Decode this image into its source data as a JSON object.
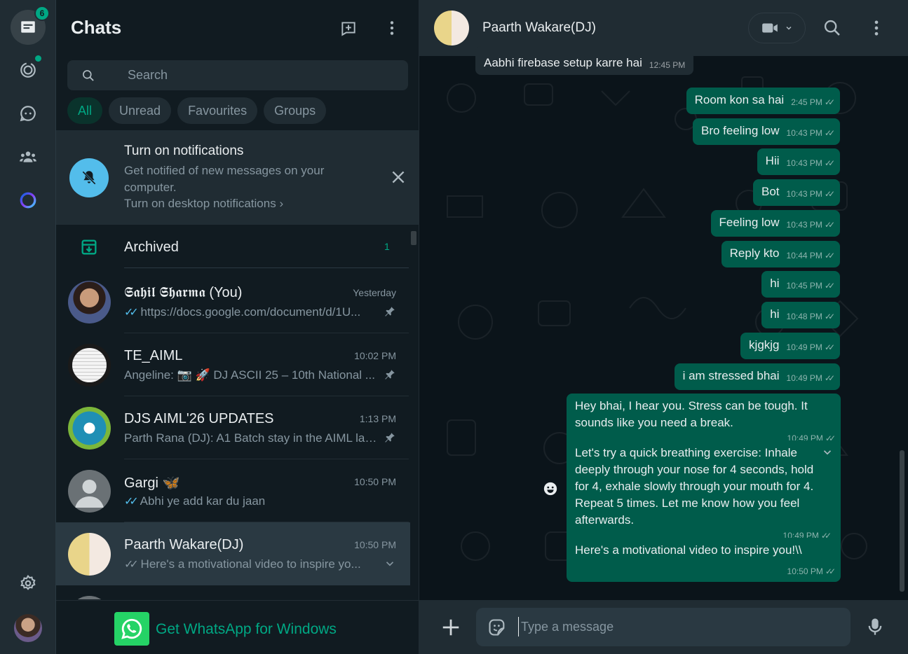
{
  "rail": {
    "chats_badge": "6",
    "icons": [
      "chats-icon",
      "status-icon",
      "channels-icon",
      "communities-icon",
      "meta-ai-icon",
      "settings-icon"
    ]
  },
  "sidebar": {
    "title": "Chats",
    "search_placeholder": "Search",
    "filters": [
      "All",
      "Unread",
      "Favourites",
      "Groups"
    ],
    "notification": {
      "title": "Turn on notifications",
      "description": "Get notified of new messages on your computer.",
      "link": "Turn on desktop notifications ›"
    },
    "archived": {
      "label": "Archived",
      "count": "1"
    },
    "chats": [
      {
        "name": "𝕾𝖆𝖍𝖎𝖑 𝕾𝖍𝖆𝖗𝖒𝖆 (You)",
        "time": "Yesterday",
        "preview": "https://docs.google.com/document/d/1U...",
        "ticks": "blue",
        "pinned": true
      },
      {
        "name": "TE_AIML",
        "time": "10:02 PM",
        "preview": "Angeline: 📷 🚀 DJ ASCII 25 – 10th National ...",
        "ticks": "",
        "pinned": true
      },
      {
        "name": "DJS AIML'26 UPDATES",
        "time": "1:13 PM",
        "preview": "Parth Rana (DJ): A1 Batch stay in the AIML lab...",
        "ticks": "",
        "pinned": true
      },
      {
        "name": "Gargi 🦋",
        "time": "10:50 PM",
        "preview": "Abhi ye add kar du jaan",
        "ticks": "blue",
        "pinned": false
      },
      {
        "name": "Paarth Wakare(DJ)",
        "time": "10:50 PM",
        "preview": "Here's a motivational video to inspire yo...",
        "ticks": "grey",
        "pinned": false
      }
    ],
    "get_app": "Get WhatsApp for Windows"
  },
  "conversation": {
    "contact_name": "Paarth Wakare(DJ)",
    "composer_placeholder": "Type a message",
    "messages": [
      {
        "dir": "in",
        "text": "Aabhi firebase setup karre hai",
        "time": "12:45 PM"
      },
      {
        "dir": "out",
        "text": "Room kon sa hai",
        "time": "2:45 PM"
      },
      {
        "dir": "out",
        "text": "Bro feeling low",
        "time": "10:43 PM"
      },
      {
        "dir": "out",
        "text": "Hii",
        "time": "10:43 PM"
      },
      {
        "dir": "out",
        "text": "Bot",
        "time": "10:43 PM"
      },
      {
        "dir": "out",
        "text": "Feeling low",
        "time": "10:43 PM"
      },
      {
        "dir": "out",
        "text": "Reply kto",
        "time": "10:44 PM"
      },
      {
        "dir": "out",
        "text": "hi",
        "time": "10:45 PM"
      },
      {
        "dir": "out",
        "text": "hi",
        "time": "10:48 PM"
      },
      {
        "dir": "out",
        "text": "kjgkjg",
        "time": "10:49 PM"
      },
      {
        "dir": "out",
        "text": "i am stressed bhai",
        "time": "10:49 PM"
      },
      {
        "dir": "out",
        "text": "Hey bhai, I hear you.  Stress can be tough.  It sounds like you need a break.",
        "time": "10:49 PM"
      },
      {
        "dir": "out",
        "text": "Let's try a quick breathing exercise:  Inhale deeply through your nose for 4 seconds, hold for 4, exhale slowly through your mouth for 4.  Repeat 5 times.  Let me know how you feel afterwards.",
        "time": "10:49 PM"
      },
      {
        "dir": "out",
        "text": "Here's a motivational video to inspire you!\\\\",
        "time": "10:50 PM"
      }
    ]
  }
}
